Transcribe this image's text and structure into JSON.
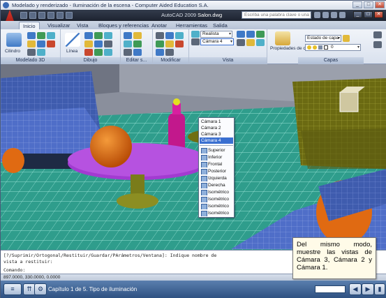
{
  "course_window": {
    "title": "Modelado y renderizado - Iluminación de la escena - Computer Aided Education S.A.",
    "controls": [
      "_",
      "□",
      "✕"
    ]
  },
  "autocad": {
    "app_name": "AutoCAD 2009",
    "file_name": "Salon.dwg",
    "search_placeholder": "Escriba una palabra clave o una frase"
  },
  "ribbon": {
    "tabs": [
      "Inicio",
      "Visualizar",
      "Vista",
      "Bloques y referencias",
      "Anotar",
      "Herramientas",
      "Salida"
    ],
    "active_tab": "Inicio",
    "panels": [
      "Modelado 3D",
      "Dibujo",
      "Editar s...",
      "Modificar",
      "Vista",
      "Capas"
    ],
    "cilindro_label": "Cilindro",
    "linea_label": "Línea",
    "visual_style": "Realista",
    "camera_combo": "Cámara 4",
    "layer_props_label": "Propiedades de capa",
    "layer_state": "Estado de capa",
    "layer_current": "0"
  },
  "camera_dropdown": {
    "cameras": [
      "Cámara 1",
      "Cámara 2",
      "Cámara 3",
      "Cámara 4"
    ],
    "selected": "Cámara 4",
    "views": [
      "Superior",
      "Inferior",
      "Frontal",
      "Posterior",
      "Izquierda",
      "Derecha",
      "Isométrico",
      "Isométrico",
      "Isométrico",
      "Isométrico"
    ]
  },
  "command_line": {
    "line1": "[?/Suprimir/Ortogonal/Restituir/Guardar/PArámetros/Ventana]: Indique nombre de",
    "line2": "vista a restituir:",
    "prompt": "Comando:"
  },
  "coordinates": "897.0000, 330.0000, 0.0000",
  "callout_text": "Del mismo modo, muestre las vistas de Cámara 3, Cámara 2 y Cámara 1.",
  "navigation": {
    "chapter_text": "Capítulo 1 de 5.  Tipo de iluminación",
    "prev_icon": "up-chevrons-icon",
    "settings_icon": "gear-icon"
  },
  "colors": {
    "floor": "#2f9d8c",
    "table": "#a23bd1",
    "sofa": "#4f6ec8",
    "sofa_arm": "#e06a12",
    "accent_blue": "#3a6fd0"
  }
}
